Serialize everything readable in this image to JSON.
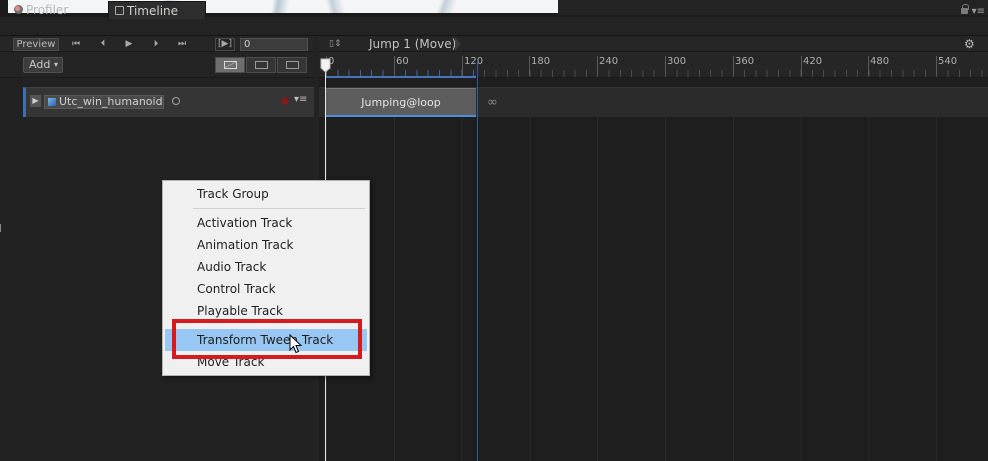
{
  "tabs": {
    "profiler": "Profiler",
    "timeline": "Timeline"
  },
  "toolbar": {
    "preview_label": "Preview",
    "first_frame": "⏮",
    "prev_frame": "⏴",
    "play": "▶",
    "next_frame": "⏵",
    "last_frame": "⏭",
    "play_range": "[▶]",
    "frame_value": "0",
    "add_label": "Add"
  },
  "timeline": {
    "breadcrumb": "Jump 1 (Move)",
    "ruler_labels": [
      "0",
      "60",
      "120",
      "180",
      "240",
      "300",
      "360",
      "420",
      "480",
      "540"
    ],
    "clip_label": "Jumping@loop",
    "loop_icon": "∞"
  },
  "track": {
    "binding_name": "Utc_win_humanoid"
  },
  "context_menu": {
    "items": [
      "Track Group",
      "Activation Track",
      "Animation Track",
      "Audio Track",
      "Control Track",
      "Playable Track",
      "Transform Tween Track",
      "Move Track"
    ],
    "highlighted_index": 6
  },
  "colors": {
    "highlight": "#97c7f2",
    "annotation": "#d51b1f",
    "track_accent": "#3c6fb3",
    "clip_underline": "#4a8fd8"
  }
}
